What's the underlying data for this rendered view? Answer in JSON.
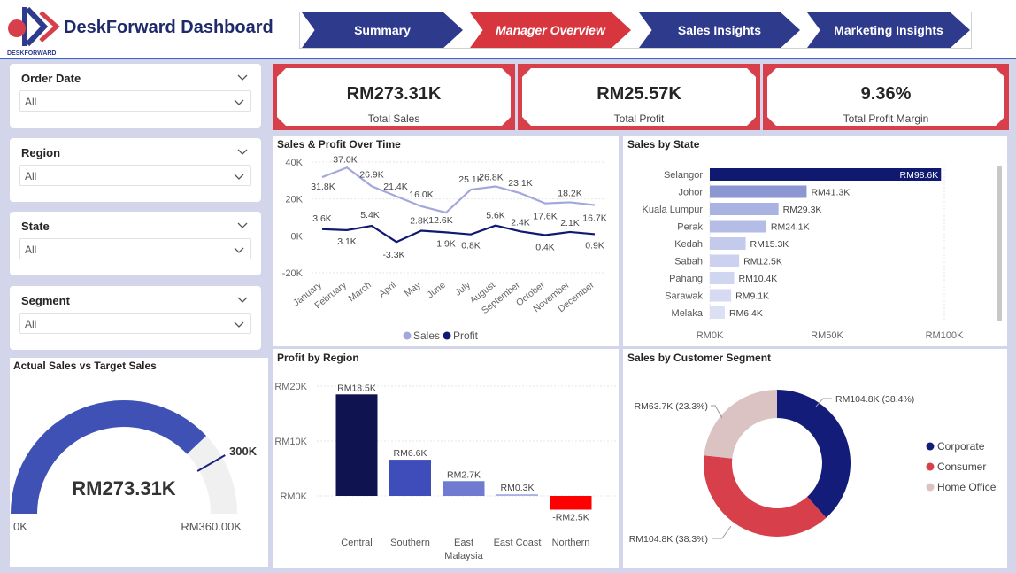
{
  "header": {
    "title": "DeskForward Dashboard",
    "logo_text": "DESKFORWARD",
    "nav": [
      {
        "label": "Summary",
        "active": false
      },
      {
        "label": "Manager Overview",
        "active": true
      },
      {
        "label": "Sales Insights",
        "active": false
      },
      {
        "label": "Marketing Insights",
        "active": false
      }
    ]
  },
  "slicers": [
    {
      "title": "Order Date",
      "value": "All"
    },
    {
      "title": "Region",
      "value": "All"
    },
    {
      "title": "State",
      "value": "All"
    },
    {
      "title": "Segment",
      "value": "All"
    }
  ],
  "kpis": [
    {
      "value": "RM273.31K",
      "label": "Total Sales"
    },
    {
      "value": "RM25.57K",
      "label": "Total Profit"
    },
    {
      "value": "9.36%",
      "label": "Total Profit Margin"
    }
  ],
  "gauge": {
    "title": "Actual Sales vs Target Sales",
    "value_label": "RM273.31K",
    "min_label": "0K",
    "max_label": "RM360.00K",
    "target_label": "300K",
    "value": 273.31,
    "target": 300,
    "max": 360
  },
  "colors": {
    "navy": "#0f1970",
    "light_purple": "#a3a8dc",
    "red": "#d7404a",
    "gauge_fill": "#3f51b5",
    "gauge_track": "#f0f0f0"
  },
  "chart_data": [
    {
      "type": "line",
      "title": "Sales & Profit Over Time",
      "categories": [
        "January",
        "February",
        "March",
        "April",
        "May",
        "June",
        "July",
        "August",
        "September",
        "October",
        "November",
        "December"
      ],
      "ylim": [
        -20,
        40
      ],
      "yticks": [
        "40K",
        "20K",
        "0K",
        "-20K"
      ],
      "series": [
        {
          "name": "Sales",
          "color": "#a3a8dc",
          "values": [
            31.8,
            37.0,
            26.9,
            21.4,
            16.0,
            12.6,
            25.1,
            26.8,
            23.1,
            17.6,
            18.2,
            16.7
          ],
          "labels": [
            "31.8K",
            "37.0K",
            "26.9K",
            "21.4K",
            "16.0K",
            "12.6K",
            "25.1K",
            "26.8K",
            "23.1K",
            "17.6K",
            "18.2K",
            "16.7K"
          ]
        },
        {
          "name": "Profit",
          "color": "#0f1970",
          "values": [
            3.6,
            3.1,
            5.4,
            -3.3,
            2.8,
            1.9,
            0.8,
            5.6,
            2.4,
            0.4,
            2.1,
            0.9
          ],
          "labels": [
            "3.6K",
            "3.1K",
            "5.4K",
            "-3.3K",
            "2.8K",
            "1.9K",
            "0.8K",
            "5.6K",
            "2.4K",
            "0.4K",
            "2.1K",
            "0.9K"
          ]
        }
      ]
    },
    {
      "type": "bar",
      "orientation": "horizontal",
      "title": "Sales by State",
      "categories": [
        "Selangor",
        "Johor",
        "Kuala Lumpur",
        "Perak",
        "Kedah",
        "Sabah",
        "Pahang",
        "Sarawak",
        "Melaka"
      ],
      "values": [
        98.6,
        41.3,
        29.3,
        24.1,
        15.3,
        12.5,
        10.4,
        9.1,
        6.4
      ],
      "labels": [
        "RM98.6K",
        "RM41.3K",
        "RM29.3K",
        "RM24.1K",
        "RM15.3K",
        "RM12.5K",
        "RM10.4K",
        "RM9.1K",
        "RM6.4K"
      ],
      "xlim": [
        0,
        100
      ],
      "xticks": [
        "RM0K",
        "RM50K",
        "RM100K"
      ]
    },
    {
      "type": "bar",
      "title": "Profit by Region",
      "categories": [
        "Central",
        "Southern",
        "East Malaysia",
        "East Coast",
        "Northern"
      ],
      "values": [
        18.5,
        6.6,
        2.7,
        0.3,
        -2.5
      ],
      "labels": [
        "RM18.5K",
        "RM6.6K",
        "RM2.7K",
        "RM0.3K",
        "-RM2.5K"
      ],
      "colors": [
        "#0f1450",
        "#3f4dbb",
        "#6f7ad0",
        "#a9b0e4",
        "#ff0000"
      ],
      "ylim": [
        -3,
        20
      ],
      "yticks": [
        "RM20K",
        "RM10K",
        "RM0K"
      ]
    },
    {
      "type": "pie",
      "title": "Sales by Customer Segment",
      "categories": [
        "Corporate",
        "Consumer",
        "Home Office"
      ],
      "values": [
        104.8,
        104.8,
        63.7
      ],
      "labels": [
        "RM104.8K (38.4%)",
        "RM104.8K (38.3%)",
        "RM63.7K (23.3%)"
      ],
      "colors": [
        "#141c7a",
        "#d7404a",
        "#dcc3c3"
      ]
    }
  ]
}
